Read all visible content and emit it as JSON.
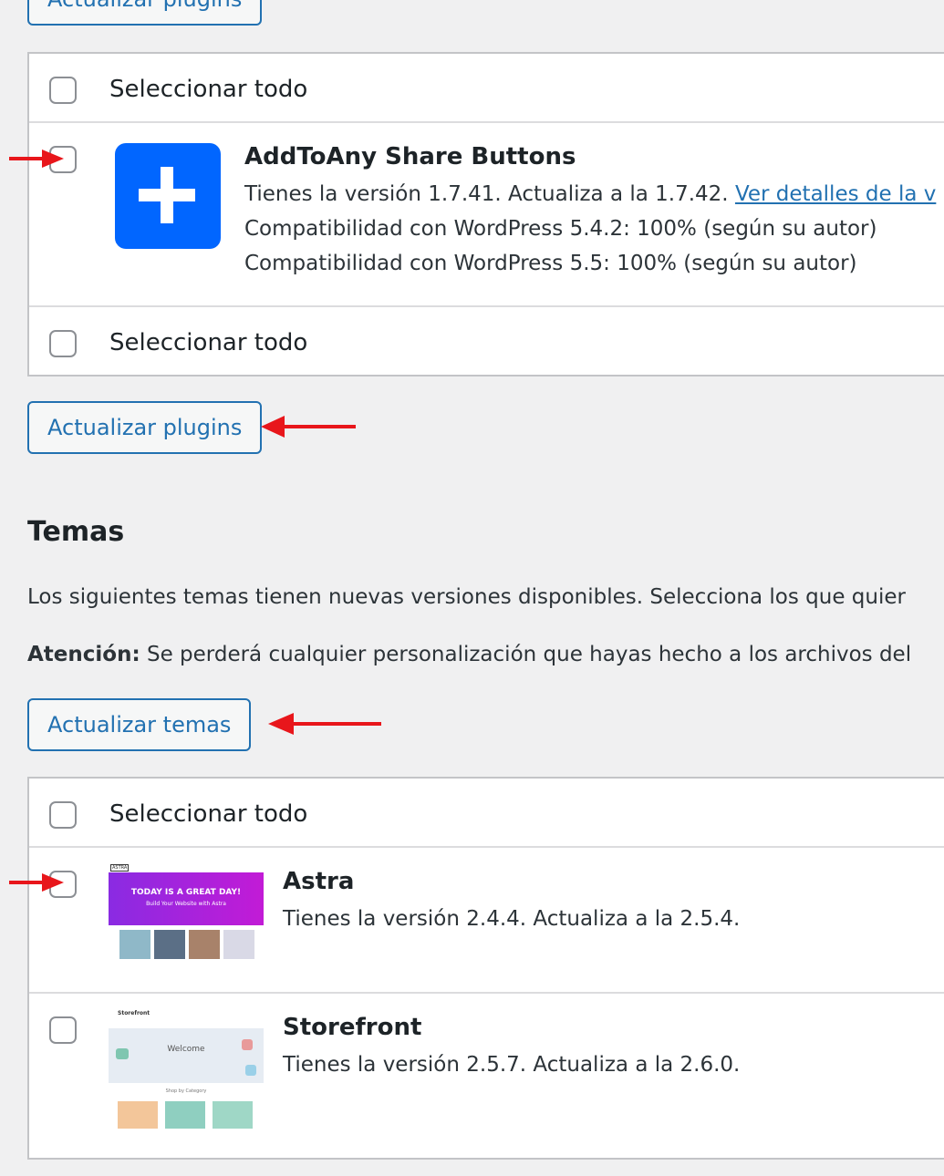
{
  "top_button": {
    "label": "Actualizar plugins"
  },
  "plugins_table": {
    "select_all_top": "Seleccionar todo",
    "select_all_bottom": "Seleccionar todo",
    "plugin": {
      "name": "AddToAny Share Buttons",
      "version_text": "Tienes la versión 1.7.41. Actualiza a la 1.7.42.",
      "details_link": "Ver detalles de la v",
      "compat1": "Compatibilidad con WordPress 5.4.2: 100% (según su autor)",
      "compat2": "Compatibilidad con WordPress 5.5: 100% (según su autor)",
      "icon_color": "#0166ff"
    }
  },
  "update_plugins_button": {
    "label": "Actualizar plugins"
  },
  "themes_section": {
    "heading": "Temas",
    "description": "Los siguientes temas tienen nuevas versiones disponibles. Selecciona los que quier",
    "warning_label": "Atención:",
    "warning_text": " Se perderá cualquier personalización que hayas hecho a los archivos del",
    "update_button": "Actualizar temas",
    "select_all": "Seleccionar todo",
    "themes": [
      {
        "name": "Astra",
        "version_text": "Tienes la versión 2.4.4. Actualiza a la 2.5.4.",
        "thumb": {
          "brand": "ASTRA",
          "headline": "TODAY IS A GREAT DAY!",
          "subline": "Build Your Website with Astra"
        }
      },
      {
        "name": "Storefront",
        "version_text": "Tienes la versión 2.5.7. Actualiza a la 2.6.0.",
        "thumb": {
          "brand": "Storefront",
          "headline": "Welcome",
          "subline": "Shop by Category"
        }
      }
    ]
  },
  "colors": {
    "accent": "#2271b1",
    "annotation_arrow": "#e8161b"
  }
}
